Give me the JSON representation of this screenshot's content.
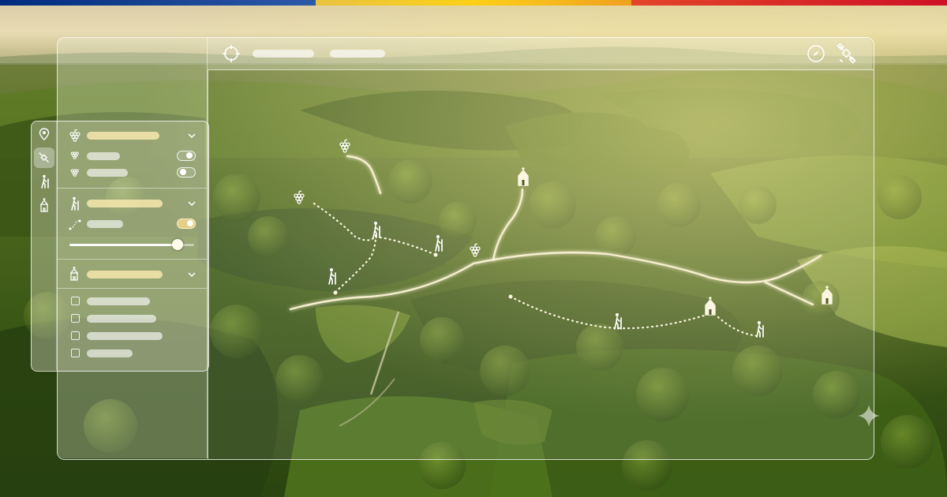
{
  "colors": {
    "flag_blue": "#002b7f",
    "flag_yellow": "#fcd116",
    "flag_red": "#ce1126",
    "forest_dark": "#2c4414",
    "forest_light": "#7e9a32",
    "path_glow": "#f6efcf"
  },
  "topbar": {
    "icons": [
      "crosshair-icon",
      "compass-icon",
      "satellite-icon"
    ]
  },
  "sidebar": {
    "rail_icons": [
      "map-pin-icon",
      "satellite-icon",
      "hiker-icon",
      "church-icon"
    ],
    "active_rail": "satellite",
    "sections": [
      {
        "icon": "grapes-icon",
        "expanded": true,
        "rows": [
          {
            "icon": "grapes-icon",
            "toggle": false
          },
          {
            "icon": "grapes-icon",
            "toggle": false
          }
        ]
      },
      {
        "icon": "hiker-icon",
        "expanded": true,
        "rows": [
          {
            "icon": "dotted-route-icon",
            "toggle": true
          }
        ],
        "slider_level": 0.87
      },
      {
        "icon": "church-icon",
        "expanded": true,
        "checkbox_rows": 4
      }
    ]
  },
  "map": {
    "markers": [
      "grapes-icon",
      "grapes-icon",
      "grapes-icon",
      "church-icon",
      "church-icon",
      "church-icon",
      "hiker-icon",
      "hiker-icon",
      "hiker-icon",
      "hiker-icon",
      "hiker-icon"
    ]
  }
}
